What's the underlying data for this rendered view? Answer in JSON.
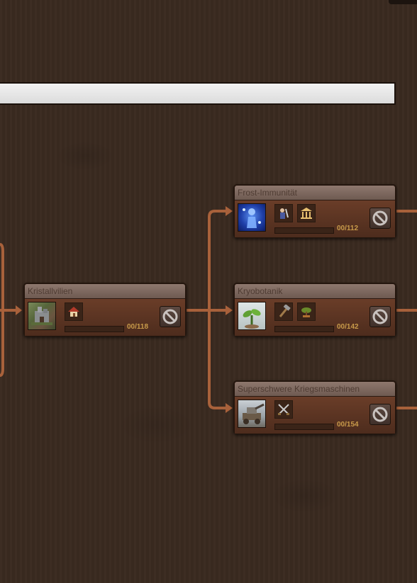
{
  "colors": {
    "background": "#3a2a20",
    "connector": "#a8613b",
    "count_text": "#c89a4a",
    "title_text": "#4f3c33"
  },
  "cards": {
    "kristallvilien": {
      "title": "Kristallvilien",
      "count": "00/118",
      "progress": 0,
      "portrait_icon": "fortress-portrait",
      "prerequisite_icons": [
        "house-icon"
      ]
    },
    "frost": {
      "title": "Frost-Immunität",
      "count": "00/112",
      "progress": 0,
      "portrait_icon": "frost-figure-portrait",
      "prerequisite_icons": [
        "scientist-icon",
        "academy-icon"
      ]
    },
    "kryo": {
      "title": "Kryobotanik",
      "count": "00/142",
      "progress": 0,
      "portrait_icon": "sprout-portrait",
      "prerequisite_icons": [
        "hammer-icon",
        "bonsai-icon"
      ]
    },
    "kriegs": {
      "title": "Superschwere Kriegsmaschinen",
      "count": "00/154",
      "progress": 0,
      "portrait_icon": "war-machine-portrait",
      "prerequisite_icons": [
        "crossed-swords-icon"
      ]
    }
  },
  "block_icon": "blocked-icon"
}
